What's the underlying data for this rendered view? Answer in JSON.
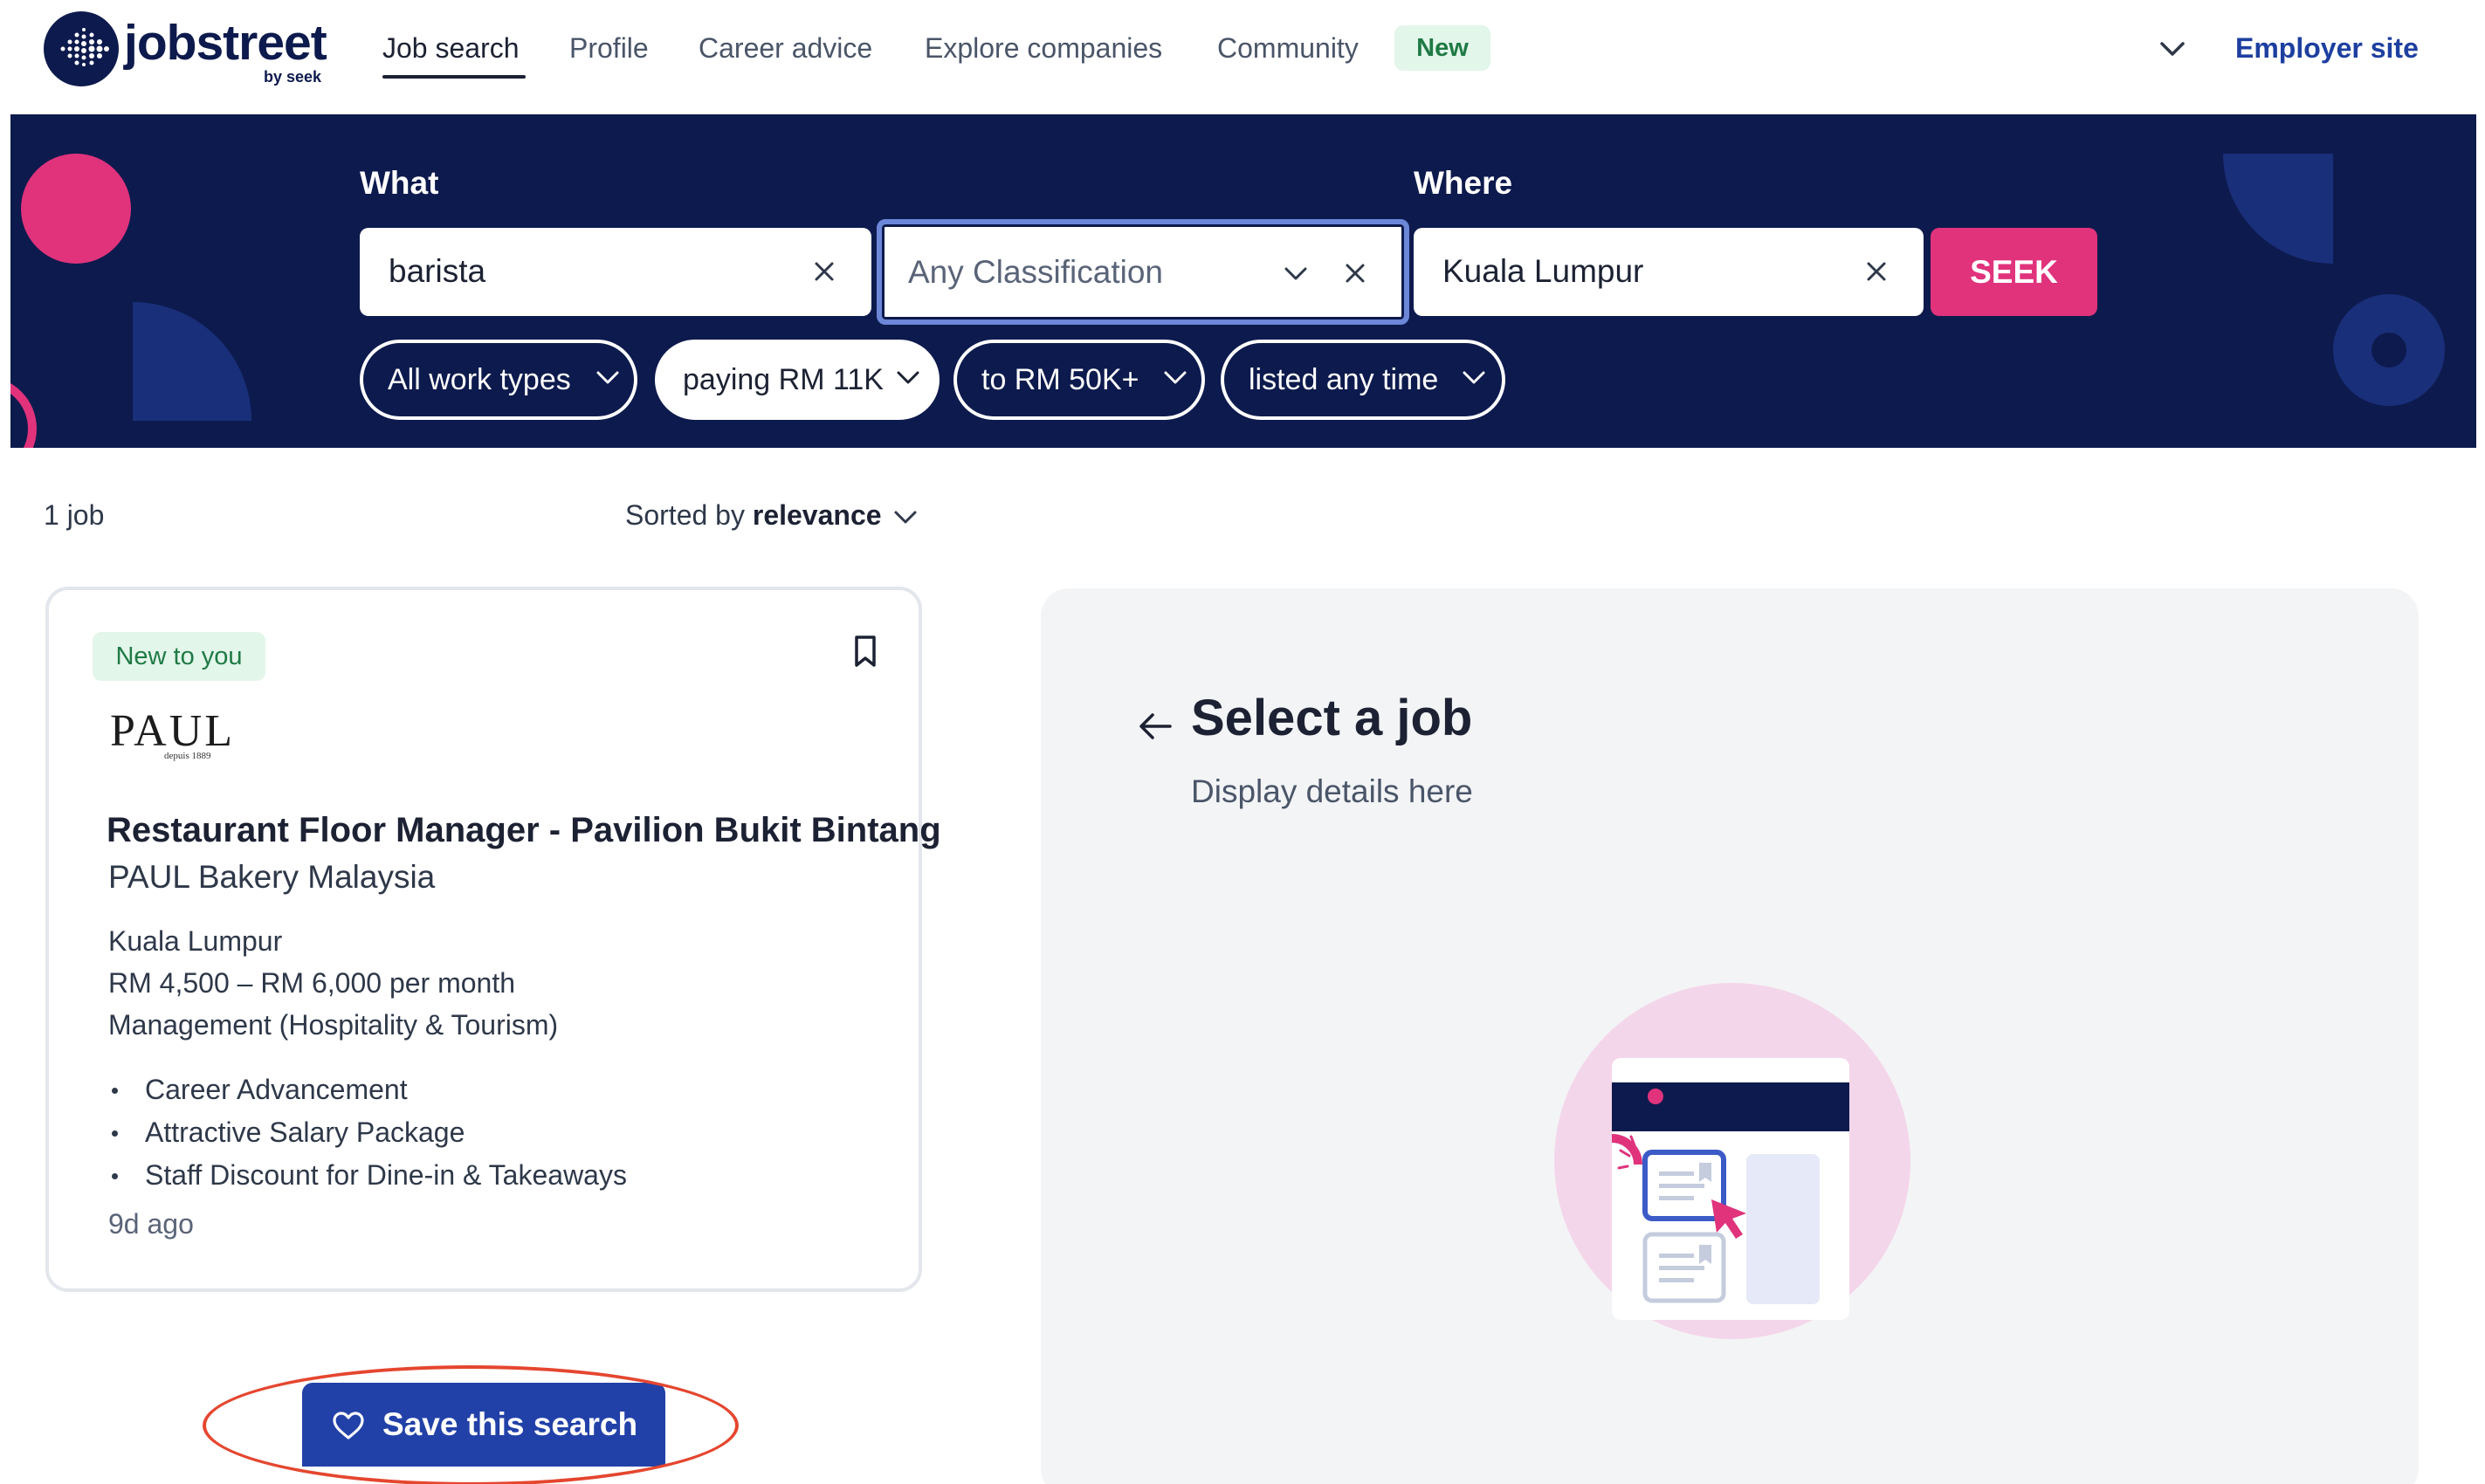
{
  "header": {
    "logo_text": "jobstreet",
    "logo_sub": "by seek",
    "nav": [
      {
        "label": "Job search",
        "active": true
      },
      {
        "label": "Profile"
      },
      {
        "label": "Career advice"
      },
      {
        "label": "Explore companies"
      },
      {
        "label": "Community"
      }
    ],
    "new_badge": "New",
    "employer_link": "Employer site"
  },
  "search": {
    "what_label": "What",
    "where_label": "Where",
    "keyword_value": "barista",
    "classification_placeholder": "Any Classification",
    "location_value": "Kuala Lumpur",
    "submit_label": "SEEK",
    "filters": [
      "All work types",
      "paying RM 11K",
      "to RM 50K+",
      "listed any time"
    ]
  },
  "results": {
    "count_text": "1 job",
    "sorted_prefix": "Sorted by",
    "sorted_value": "relevance"
  },
  "job": {
    "badge": "New to you",
    "company_logo_text": "PAUL",
    "company_logo_sub": "depuis 1889",
    "title": "Restaurant Floor Manager - Pavilion Bukit Bintang",
    "company": "PAUL Bakery Malaysia",
    "location": "Kuala Lumpur",
    "salary": "RM 4,500 – RM 6,000 per month",
    "classification": "Management  (Hospitality & Tourism)",
    "highlights": [
      "Career Advancement",
      "Attractive Salary Package",
      "Staff Discount for Dine-in & Takeaways"
    ],
    "listed": "9d ago"
  },
  "save_search": {
    "label": "Save this search",
    "icon": "heart-icon"
  },
  "details": {
    "title": "Select a job",
    "subtitle": "Display details here"
  },
  "colors": {
    "navy": "#0d1a4d",
    "pink": "#e0337c",
    "blue_button": "#2241a8",
    "annotation_red": "#e5462f",
    "green_badge_bg": "#e3f6ea"
  }
}
